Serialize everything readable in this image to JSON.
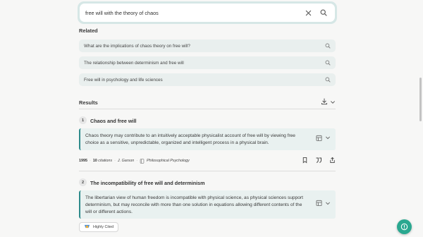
{
  "search": {
    "query": "free will with the theory of chaos"
  },
  "related": {
    "title": "Related",
    "items": [
      "What are the implications of chaos theory on free will?",
      "The relationship between determinism and free will",
      "Free will in psychology and life sciences"
    ]
  },
  "results": {
    "title": "Results",
    "papers": [
      {
        "number": "1",
        "title": "Chaos and free will",
        "abstract": "Chaos theory may contribute to an intuitively acceptable physicalist account of free will by viewing free choice as a sensitive, unpredictable, organized and intelligent process in a physical brain.",
        "year": "1995",
        "citations_count": "10",
        "citations_label": "citations",
        "author": "J. Garson",
        "journal": "Philosophical Psychology"
      },
      {
        "number": "2",
        "title": "The incompatibility of free will and determinism",
        "abstract": "The libertarian view of human freedom is incompatible with physical science, as physical sciences support determinism, but may reconcile with more than one solution in equations allowing different contents of the will or different actions.",
        "badge": "Highly Cited"
      }
    ]
  },
  "colors": {
    "accent": "#2e8b8b",
    "fab": "#2aa890",
    "tile": "#e9efee"
  },
  "icons": [
    "clear-icon",
    "search-icon",
    "download-icon",
    "chevron-down-icon",
    "table-icon",
    "bookmark-icon",
    "quote-icon",
    "share-icon",
    "medal-icon",
    "chat-icon"
  ]
}
